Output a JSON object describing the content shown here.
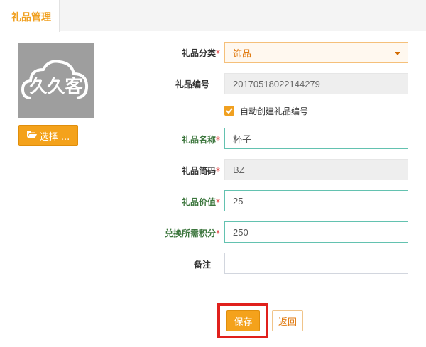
{
  "tab": {
    "label": "礼品管理"
  },
  "logo": {
    "text": "久久客"
  },
  "picker": {
    "label": "选择 ...",
    "icon": "folder-open-icon"
  },
  "form": {
    "required_mark": "*",
    "category": {
      "label": "礼品分类",
      "value": "饰品",
      "required": true
    },
    "code": {
      "label": "礼品编号",
      "value": "20170518022144279"
    },
    "auto_code": {
      "label": "自动创建礼品编号",
      "checked": true
    },
    "name": {
      "label": "礼品名称",
      "value": "杯子",
      "required": true
    },
    "short": {
      "label": "礼品简码",
      "value": "BZ",
      "required": true
    },
    "price": {
      "label": "礼品价值",
      "value": "25",
      "required": true
    },
    "points": {
      "label": "兑换所需积分",
      "value": "250",
      "required": true
    },
    "note": {
      "label": "备注",
      "value": ""
    }
  },
  "actions": {
    "save": "保存",
    "back": "返回"
  },
  "colors": {
    "accent": "#f4a21b",
    "highlight": "#e0201c",
    "valid_label": "#3c763d"
  }
}
